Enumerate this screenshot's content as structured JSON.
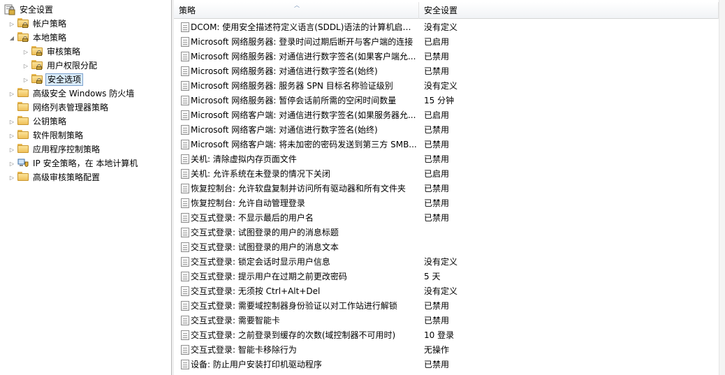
{
  "tree": [
    {
      "label": "安全设置",
      "expander": "",
      "icon": "security-settings-icon"
    },
    {
      "label": "帐户策略",
      "expander": "▷",
      "icon": "folder-lock-icon"
    },
    {
      "label": "本地策略",
      "expander": "◢",
      "icon": "folder-lock-icon"
    },
    {
      "label": "审核策略",
      "expander": "▷",
      "icon": "folder-lock-icon"
    },
    {
      "label": "用户权限分配",
      "expander": "▷",
      "icon": "folder-lock-icon"
    },
    {
      "label": "安全选项",
      "expander": "▷",
      "icon": "folder-lock-icon",
      "selected": true
    },
    {
      "label": "高级安全 Windows 防火墙",
      "expander": "▷",
      "icon": "folder-icon"
    },
    {
      "label": "网络列表管理器策略",
      "expander": "",
      "icon": "folder-icon"
    },
    {
      "label": "公钥策略",
      "expander": "▷",
      "icon": "folder-icon"
    },
    {
      "label": "软件限制策略",
      "expander": "▷",
      "icon": "folder-icon"
    },
    {
      "label": "应用程序控制策略",
      "expander": "▷",
      "icon": "folder-icon"
    },
    {
      "label": "IP 安全策略，在 本地计算机",
      "expander": "▷",
      "icon": "ip-security-icon"
    },
    {
      "label": "高级审核策略配置",
      "expander": "▷",
      "icon": "folder-icon"
    }
  ],
  "list": {
    "headers": {
      "policy": "策略",
      "setting": "安全设置"
    },
    "rows": [
      {
        "policy": "DCOM: 使用安全描述符定义语言(SDDL)语法的计算机启动...",
        "setting": "没有定义"
      },
      {
        "policy": "Microsoft 网络服务器: 登录时间过期后断开与客户端的连接",
        "setting": "已启用"
      },
      {
        "policy": "Microsoft 网络服务器: 对通信进行数字签名(如果客户端允...",
        "setting": "已禁用"
      },
      {
        "policy": "Microsoft 网络服务器: 对通信进行数字签名(始终)",
        "setting": "已禁用"
      },
      {
        "policy": "Microsoft 网络服务器: 服务器 SPN 目标名称验证级别",
        "setting": "没有定义"
      },
      {
        "policy": "Microsoft 网络服务器: 暂停会话前所需的空闲时间数量",
        "setting": "15 分钟"
      },
      {
        "policy": "Microsoft 网络客户端: 对通信进行数字签名(如果服务器允...",
        "setting": "已启用"
      },
      {
        "policy": "Microsoft 网络客户端: 对通信进行数字签名(始终)",
        "setting": "已禁用"
      },
      {
        "policy": "Microsoft 网络客户端: 将未加密的密码发送到第三方 SMB...",
        "setting": "已禁用"
      },
      {
        "policy": "关机: 清除虚拟内存页面文件",
        "setting": "已禁用"
      },
      {
        "policy": "关机: 允许系统在未登录的情况下关闭",
        "setting": "已启用"
      },
      {
        "policy": "恢复控制台: 允许软盘复制并访问所有驱动器和所有文件夹",
        "setting": "已禁用"
      },
      {
        "policy": "恢复控制台: 允许自动管理登录",
        "setting": "已禁用"
      },
      {
        "policy": "交互式登录: 不显示最后的用户名",
        "setting": "已禁用"
      },
      {
        "policy": "交互式登录: 试图登录的用户的消息标题",
        "setting": ""
      },
      {
        "policy": "交互式登录: 试图登录的用户的消息文本",
        "setting": ""
      },
      {
        "policy": "交互式登录: 锁定会话时显示用户信息",
        "setting": "没有定义"
      },
      {
        "policy": "交互式登录: 提示用户在过期之前更改密码",
        "setting": "5 天"
      },
      {
        "policy": "交互式登录: 无须按 Ctrl+Alt+Del",
        "setting": "没有定义"
      },
      {
        "policy": "交互式登录: 需要域控制器身份验证以对工作站进行解锁",
        "setting": "已禁用"
      },
      {
        "policy": "交互式登录: 需要智能卡",
        "setting": "已禁用"
      },
      {
        "policy": "交互式登录: 之前登录到缓存的次数(域控制器不可用时)",
        "setting": "10 登录"
      },
      {
        "policy": "交互式登录: 智能卡移除行为",
        "setting": "无操作"
      },
      {
        "policy": "设备: 防止用户安装打印机驱动程序",
        "setting": "已禁用"
      }
    ]
  }
}
